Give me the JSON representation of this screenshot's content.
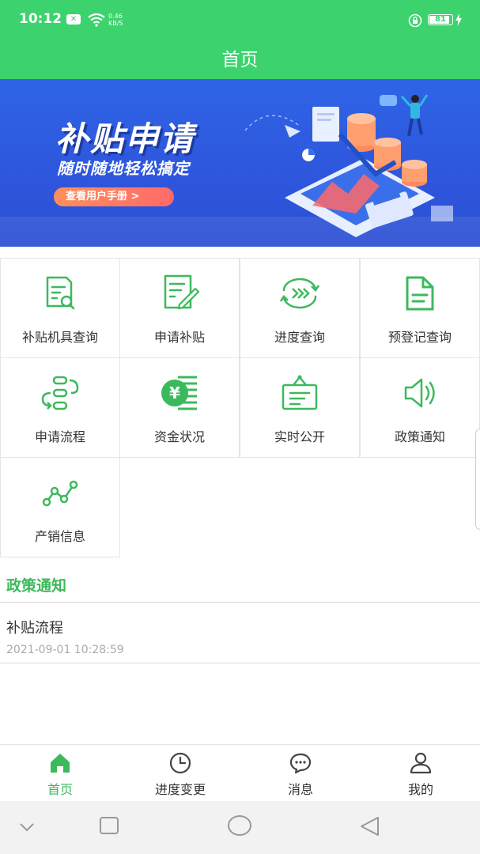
{
  "status": {
    "time": "10:12",
    "notification_badge": "✕",
    "speed_value": "0.46",
    "speed_unit": "KB/S",
    "battery": "81"
  },
  "header": {
    "title": "首页"
  },
  "banner": {
    "title": "补贴申请",
    "subtitle": "随时随地轻松搞定",
    "button": "查看用户手册 >"
  },
  "grid": [
    {
      "label": "补贴机具查询",
      "icon": "document-search-icon"
    },
    {
      "label": "申请补贴",
      "icon": "document-edit-icon"
    },
    {
      "label": "进度查询",
      "icon": "progress-arrows-icon"
    },
    {
      "label": "预登记查询",
      "icon": "file-icon"
    },
    {
      "label": "申请流程",
      "icon": "flow-icon"
    },
    {
      "label": "资金状况",
      "icon": "yen-coin-icon"
    },
    {
      "label": "实时公开",
      "icon": "notice-board-icon"
    },
    {
      "label": "政策通知",
      "icon": "speaker-icon"
    },
    {
      "label": "产销信息",
      "icon": "line-graph-icon"
    }
  ],
  "notice_section": {
    "title": "政策通知",
    "items": [
      {
        "title": "补贴流程",
        "time": "2021-09-01 10:28:59"
      }
    ]
  },
  "tabs": [
    {
      "label": "首页",
      "icon": "home-icon",
      "active": true
    },
    {
      "label": "进度变更",
      "icon": "clock-icon",
      "active": false
    },
    {
      "label": "消息",
      "icon": "chat-icon",
      "active": false
    },
    {
      "label": "我的",
      "icon": "user-icon",
      "active": false
    }
  ],
  "colors": {
    "primary": "#3cd36e",
    "accent_text": "#3cb95c",
    "banner_blue": "#2f64e6"
  }
}
